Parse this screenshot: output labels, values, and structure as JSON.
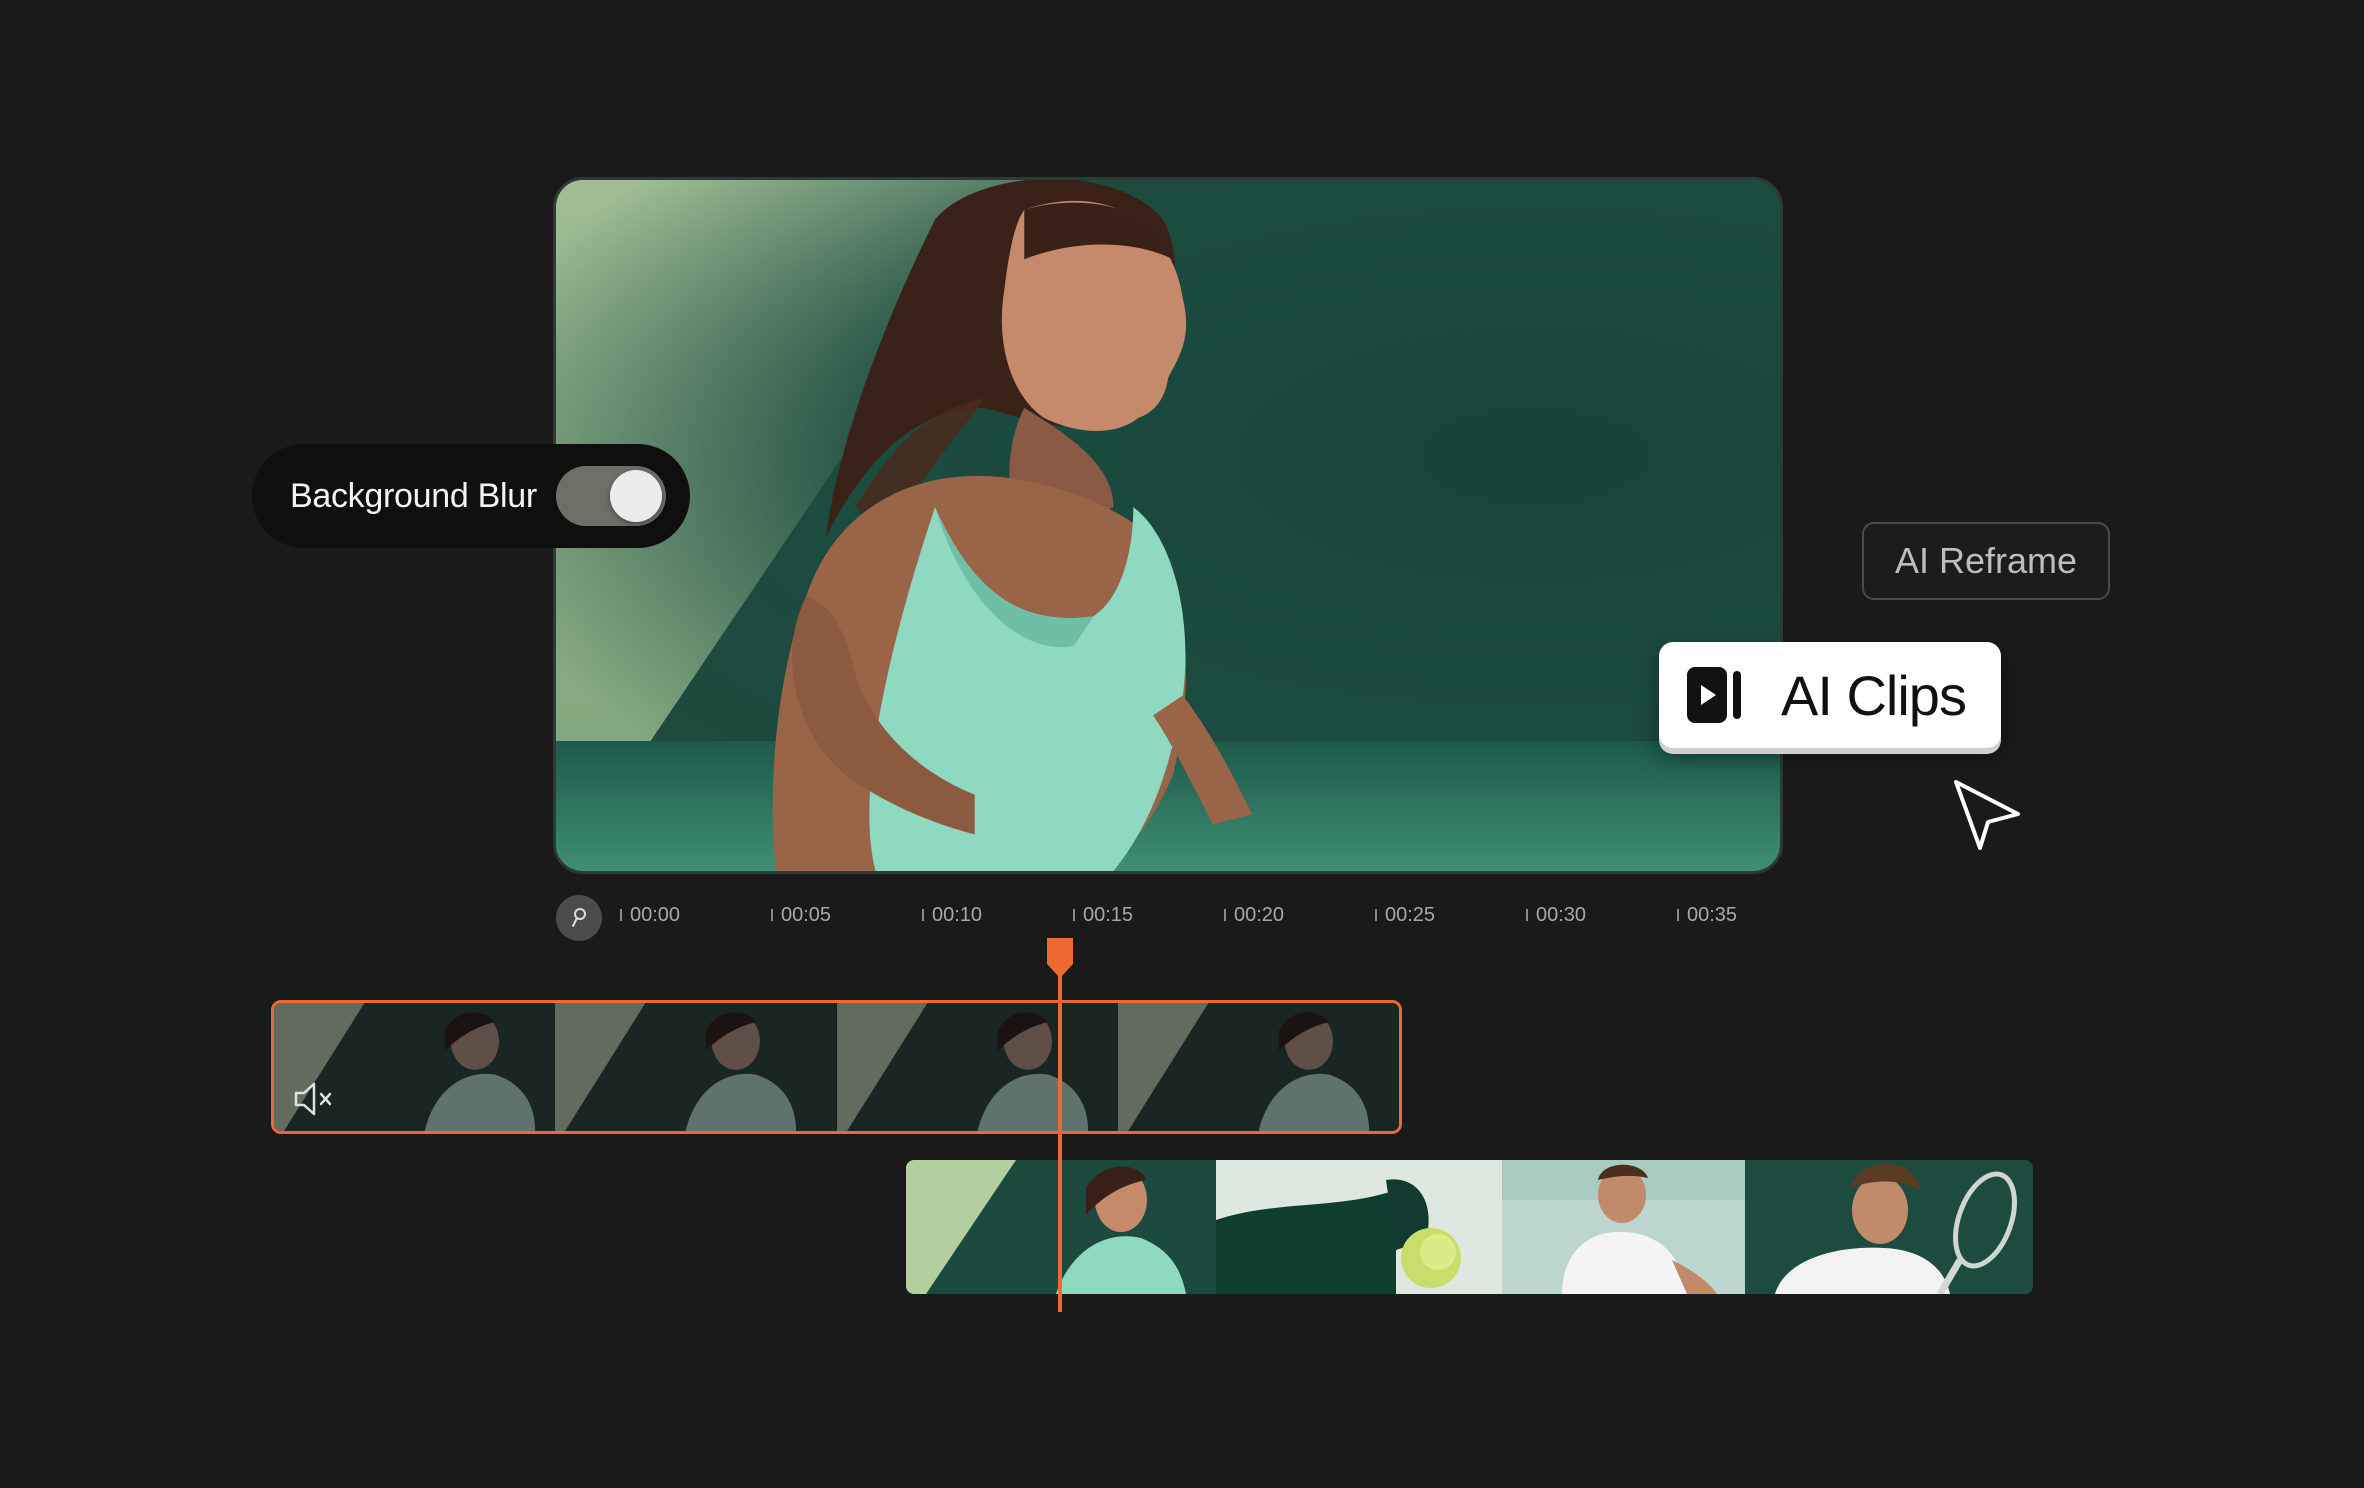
{
  "controls": {
    "background_blur_label": "Background Blur",
    "background_blur_on": true,
    "ai_reframe_label": "AI Reframe",
    "ai_clips_label": "AI Clips"
  },
  "timeline": {
    "ticks": [
      "00:00",
      "00:05",
      "00:10",
      "00:15",
      "00:20",
      "00:25",
      "00:30",
      "00:35"
    ]
  },
  "colors": {
    "accent": "#ec6a31",
    "background": "#1a1a1b"
  },
  "icons": {
    "pin": "pin-icon",
    "mute": "mute-icon",
    "clips": "clips-icon",
    "cursor": "cursor-icon"
  }
}
